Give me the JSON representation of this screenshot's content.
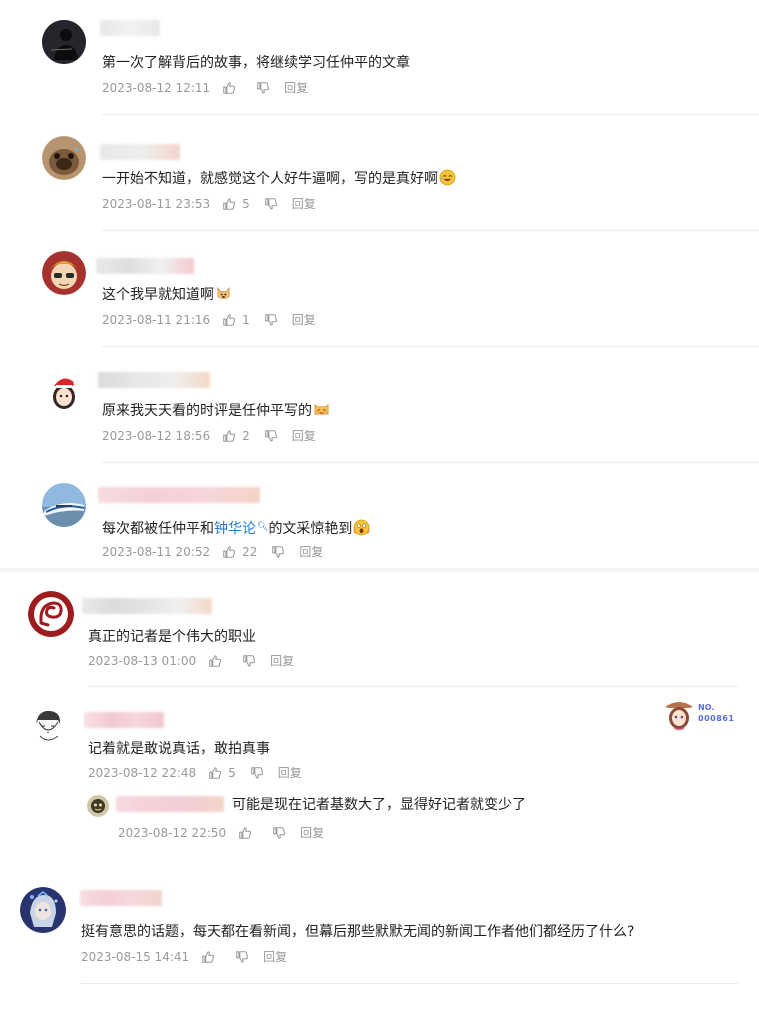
{
  "labels": {
    "reply": "回复"
  },
  "comments": [
    {
      "text": "第一次了解背后的故事，将继续学习任仲平的文章",
      "date": "2023-08-12 12:11",
      "likes": ""
    },
    {
      "text": "一开始不知道，就感觉这个人好牛逼啊，写的是真好啊",
      "date": "2023-08-11 23:53",
      "likes": "5",
      "emoji": "laugh-cry-emoji"
    },
    {
      "text": "这个我早就知道啊",
      "date": "2023-08-11 21:16",
      "likes": "1",
      "emoji": "doge-emoji"
    },
    {
      "text": "原来我天天看的时评是任仲平写的",
      "date": "2023-08-12 18:56",
      "likes": "2",
      "emoji": "cat-emoji"
    },
    {
      "text_before": "每次都被任仲平和",
      "link": "钟华论",
      "text_after": "的文采惊艳到",
      "date": "2023-08-11 20:52",
      "likes": "22",
      "emoji": "shocked-emoji"
    },
    {
      "text": "真正的记者是个伟大的职业",
      "date": "2023-08-13 01:00",
      "likes": ""
    },
    {
      "text": "记着就是敢说真话，敢拍真事",
      "date": "2023-08-12 22:48",
      "likes": "5",
      "badge": {
        "label": "NO.",
        "number": "000861"
      },
      "reply": {
        "text": "可能是现在记者基数大了，显得好记者就变少了",
        "date": "2023-08-12 22:50",
        "likes": ""
      }
    },
    {
      "text": "挺有意思的话题，每天都在看新闻，但幕后那些默默无闻的新闻工作者他们都经历了什么?",
      "date": "2023-08-15 14:41",
      "likes": ""
    }
  ]
}
